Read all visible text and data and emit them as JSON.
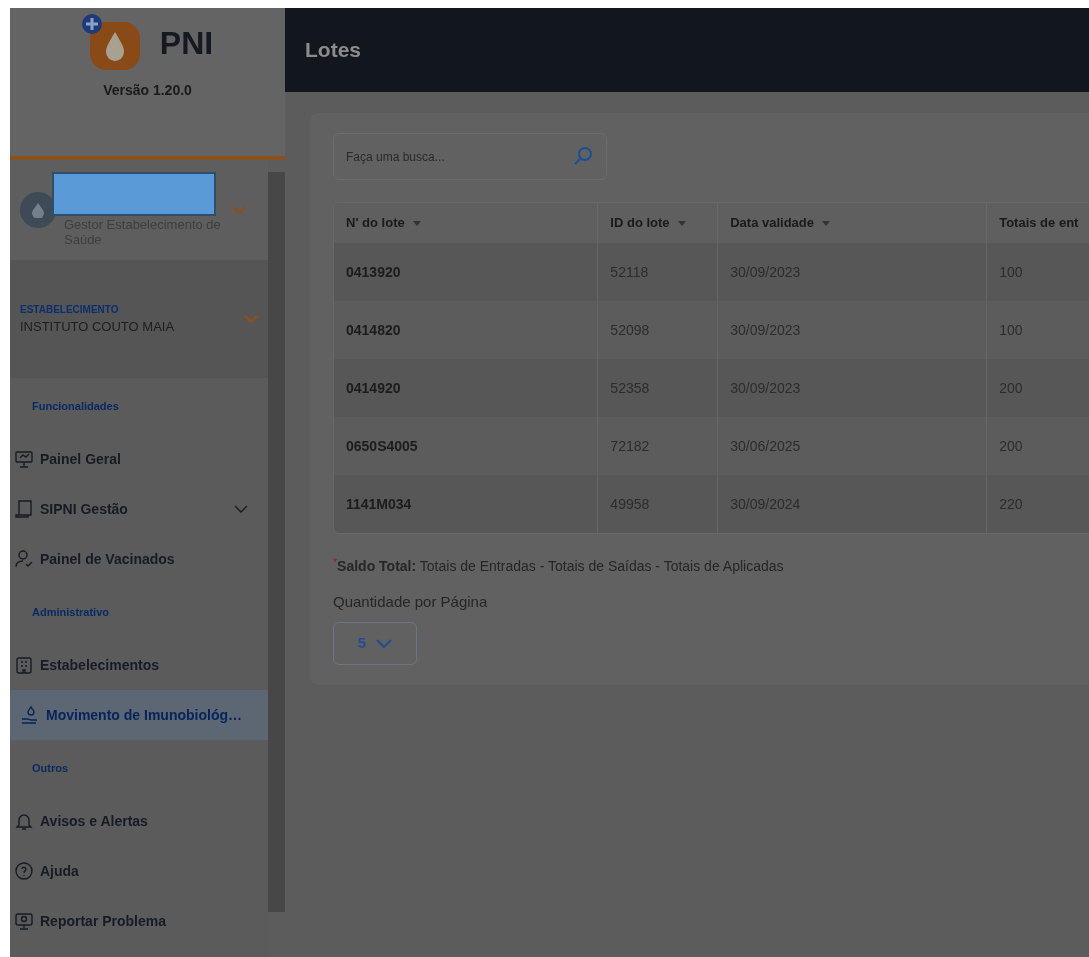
{
  "brand": {
    "name": "PNI",
    "version": "Versão 1.20.0"
  },
  "user": {
    "role": "Gestor Estabelecimento de Saúde",
    "redacted": true
  },
  "establishment": {
    "label": "ESTABELECIMENTO",
    "name": "INSTITUTO COUTO MAIA"
  },
  "nav": [
    {
      "title": "Funcionalidades",
      "items": [
        {
          "label": "Painel Geral",
          "selected": false,
          "expandable": false
        },
        {
          "label": "SIPNI Gestão",
          "selected": false,
          "expandable": true
        },
        {
          "label": "Painel de Vacinados",
          "selected": false,
          "expandable": false
        }
      ]
    },
    {
      "title": "Administrativo",
      "items": [
        {
          "label": "Estabelecimentos",
          "selected": false,
          "expandable": false
        },
        {
          "label": "Movimento de Imunobiológ…",
          "selected": true,
          "expandable": false
        }
      ]
    },
    {
      "title": "Outros",
      "items": [
        {
          "label": "Avisos e Alertas",
          "selected": false,
          "expandable": false
        },
        {
          "label": "Ajuda",
          "selected": false,
          "expandable": false
        },
        {
          "label": "Reportar Problema",
          "selected": false,
          "expandable": false
        }
      ]
    }
  ],
  "page_title": "Lotes",
  "search": {
    "placeholder": "Faça uma busca..."
  },
  "table": {
    "columns": [
      {
        "label": "N' do lote",
        "sortable": true
      },
      {
        "label": "ID do lote",
        "sortable": true
      },
      {
        "label": "Data validade",
        "sortable": true
      },
      {
        "label": "Totais de ent",
        "sortable": false
      }
    ],
    "rows": [
      [
        "0413920",
        "52118",
        "30/09/2023",
        "100"
      ],
      [
        "0414820",
        "52098",
        "30/09/2023",
        "100"
      ],
      [
        "0414920",
        "52358",
        "30/09/2023",
        "200"
      ],
      [
        "0650S4005",
        "72182",
        "30/06/2025",
        "200"
      ],
      [
        "1141M034",
        "49958",
        "30/09/2024",
        "220"
      ]
    ]
  },
  "footnote": "$^{*}$**Saldo Total:** Totais de Entradas - Totais de Saídas - Totais de Aplicadas",
  "page_size": {
    "label": "Quantidade por Página",
    "value": "5"
  }
}
